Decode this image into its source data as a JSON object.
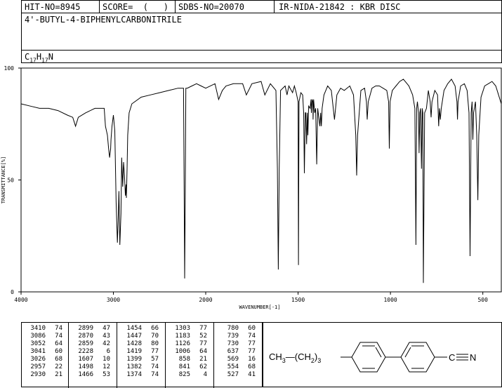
{
  "header": {
    "hit_no": "HIT-NO=8945",
    "score": "SCORE=  (   )",
    "sdbs_no": "SDBS-NO=20070",
    "ir_nida": "IR-NIDA-21842 : KBR DISC",
    "compound_name": "4'-BUTYL-4-BIPHENYLCARBONITRILE",
    "formula": {
      "main": "C",
      "sub1": "17",
      "mid": "H",
      "sub2": "17",
      "end": "N"
    }
  },
  "chart_data": {
    "type": "line",
    "title": "",
    "xlabel": "WAVENUMBER[-1]",
    "ylabel": "TRANSMITTANCE[%]",
    "xlim": [
      4000,
      400
    ],
    "ylim": [
      0,
      100
    ],
    "x_ticks": [
      "4000",
      "3000",
      "2000",
      "1500",
      "1000",
      "500"
    ],
    "y_ticks": [
      "100",
      "50",
      "0"
    ],
    "series": [
      {
        "x": [
          4000,
          3900,
          3800,
          3700,
          3600,
          3500,
          3440,
          3410,
          3380,
          3300,
          3200,
          3100,
          3086,
          3065,
          3052,
          3041,
          3030,
          3026,
          3015,
          3000,
          2985,
          2970,
          2957,
          2950,
          2940,
          2930,
          2918,
          2910,
          2899,
          2890,
          2880,
          2870,
          2862,
          2859,
          2852,
          2845,
          2830,
          2800,
          2700,
          2600,
          2500,
          2400,
          2300,
          2240,
          2233,
          2228,
          2222,
          2215,
          2200,
          2150,
          2100,
          2050,
          2000,
          1950,
          1930,
          1910,
          1890,
          1850,
          1800,
          1780,
          1750,
          1700,
          1680,
          1650,
          1620,
          1612,
          1607,
          1602,
          1595,
          1570,
          1560,
          1550,
          1530,
          1520,
          1510,
          1500,
          1498,
          1495,
          1485,
          1475,
          1470,
          1466,
          1461,
          1458,
          1454,
          1450,
          1447,
          1443,
          1435,
          1430,
          1428,
          1424,
          1420,
          1419,
          1416,
          1410,
          1405,
          1399,
          1394,
          1388,
          1382,
          1378,
          1374,
          1370,
          1360,
          1340,
          1320,
          1303,
          1290,
          1270,
          1250,
          1220,
          1200,
          1188,
          1183,
          1178,
          1160,
          1140,
          1130,
          1126,
          1120,
          1100,
          1080,
          1060,
          1040,
          1020,
          1010,
          1006,
          1002,
          990,
          970,
          950,
          930,
          910,
          900,
          880,
          868,
          862,
          858,
          854,
          848,
          845,
          841,
          837,
          832,
          828,
          825,
          822,
          815,
          805,
          795,
          785,
          780,
          775,
          760,
          745,
          739,
          735,
          730,
          725,
          710,
          690,
          670,
          650,
          640,
          637,
          634,
          620,
          600,
          585,
          575,
          569,
          563,
          558,
          554,
          550,
          540,
          533,
          527,
          522,
          510,
          490,
          470,
          450,
          430,
          415,
          400
        ],
        "y": [
          84,
          83,
          82,
          82,
          81,
          79,
          78,
          74,
          78,
          80,
          82,
          82,
          74,
          70,
          64,
          60,
          64,
          68,
          74,
          79,
          72,
          40,
          22,
          30,
          45,
          21,
          35,
          60,
          47,
          58,
          52,
          43,
          48,
          42,
          55,
          70,
          80,
          84,
          87,
          88,
          89,
          90,
          91,
          91,
          40,
          6,
          40,
          91,
          91,
          92,
          93,
          92,
          91,
          93,
          86,
          90,
          92,
          93,
          93,
          88,
          93,
          94,
          88,
          93,
          90,
          55,
          10,
          55,
          90,
          92,
          88,
          92,
          89,
          92,
          89,
          85,
          12,
          85,
          89,
          88,
          80,
          53,
          80,
          80,
          66,
          80,
          70,
          83,
          82,
          86,
          80,
          86,
          85,
          77,
          86,
          80,
          82,
          57,
          82,
          78,
          74,
          80,
          74,
          82,
          88,
          92,
          90,
          77,
          88,
          91,
          90,
          92,
          88,
          70,
          52,
          70,
          90,
          91,
          85,
          77,
          85,
          91,
          92,
          92,
          91,
          90,
          85,
          64,
          85,
          90,
          92,
          94,
          95,
          93,
          92,
          88,
          82,
          21,
          82,
          85,
          80,
          62,
          80,
          82,
          55,
          82,
          80,
          4,
          80,
          82,
          90,
          85,
          78,
          85,
          90,
          88,
          74,
          82,
          77,
          82,
          90,
          93,
          95,
          92,
          85,
          77,
          85,
          92,
          93,
          90,
          80,
          16,
          80,
          85,
          68,
          80,
          85,
          70,
          41,
          70,
          87,
          92,
          93,
          94,
          92,
          88,
          84
        ]
      }
    ],
    "peak_table": [
      {
        "wn": "3410",
        "t": "74"
      },
      {
        "wn": "3086",
        "t": "74"
      },
      {
        "wn": "3052",
        "t": "64"
      },
      {
        "wn": "3041",
        "t": "60"
      },
      {
        "wn": "3026",
        "t": "68"
      },
      {
        "wn": "2957",
        "t": "22"
      },
      {
        "wn": "2930",
        "t": "21"
      },
      {
        "wn": "2899",
        "t": "47"
      },
      {
        "wn": "2870",
        "t": "43"
      },
      {
        "wn": "2859",
        "t": "42"
      },
      {
        "wn": "2228",
        "t": "6"
      },
      {
        "wn": "1607",
        "t": "10"
      },
      {
        "wn": "1498",
        "t": "12"
      },
      {
        "wn": "1466",
        "t": "53"
      },
      {
        "wn": "1454",
        "t": "66"
      },
      {
        "wn": "1447",
        "t": "70"
      },
      {
        "wn": "1428",
        "t": "80"
      },
      {
        "wn": "1419",
        "t": "77"
      },
      {
        "wn": "1399",
        "t": "57"
      },
      {
        "wn": "1382",
        "t": "74"
      },
      {
        "wn": "1374",
        "t": "74"
      },
      {
        "wn": "1303",
        "t": "77"
      },
      {
        "wn": "1183",
        "t": "52"
      },
      {
        "wn": "1126",
        "t": "77"
      },
      {
        "wn": "1006",
        "t": "64"
      },
      {
        "wn": "858",
        "t": "21"
      },
      {
        "wn": "841",
        "t": "62"
      },
      {
        "wn": "825",
        "t": "4"
      },
      {
        "wn": "780",
        "t": "60"
      },
      {
        "wn": "739",
        "t": "74"
      },
      {
        "wn": "730",
        "t": "77"
      },
      {
        "wn": "637",
        "t": "77"
      },
      {
        "wn": "569",
        "t": "16"
      },
      {
        "wn": "554",
        "t": "68"
      },
      {
        "wn": "527",
        "t": "41"
      }
    ]
  },
  "structure": {
    "ch3": "CH",
    "ch3_sub": "3",
    "dash_paren": "—(CH",
    "ch2_sub": "2",
    "paren_close": ")",
    "count_sub": "3",
    "cn_c": "C",
    "cn_n": "N"
  }
}
